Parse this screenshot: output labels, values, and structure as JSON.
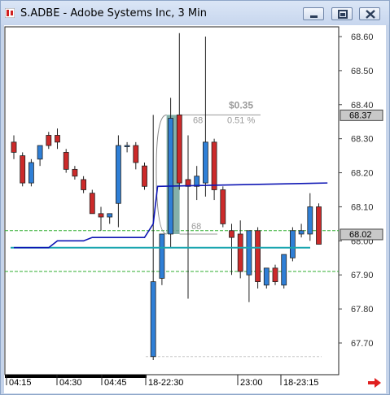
{
  "window": {
    "title": "S.ADBE - Adobe Systems Inc, 3 Min",
    "minimize_icon": "minimize-icon",
    "restore_icon": "restore-icon",
    "close_icon": "close-icon"
  },
  "colors": {
    "up_candle": "#2f7fd6",
    "down_candle": "#cc2a2a",
    "vwap_line": "#0e16b4",
    "teal_line": "#1aa6b0",
    "green_dashed": "#2fae2f",
    "gray_dashed": "#c8c8c8",
    "highlight": "#6fa29a",
    "price_tag_bg": "#c8c8c8",
    "scroll_arrow": "#e02020"
  },
  "price_axis": {
    "labels": [
      "68.60",
      "68.50",
      "68.40",
      "68.30",
      "68.20",
      "68.10",
      "68.00",
      "67.90",
      "67.80",
      "67.70"
    ],
    "current_price_tag": "68.02",
    "high_price_tag": "68.37"
  },
  "time_axis": {
    "labels": [
      "04:15",
      "04:30",
      "04:45",
      "18-22:30",
      "23:00",
      "18-23:15"
    ]
  },
  "annotation": {
    "change": "$0.35",
    "percent": "0.51 %",
    "top_bar_count": "68",
    "bottom_bar_count": "68"
  },
  "chart_data": {
    "type": "candlestick",
    "title": "S.ADBE - Adobe Systems Inc, 3 Min",
    "ylim": [
      67.64,
      68.62
    ],
    "candles": [
      {
        "open": 68.29,
        "high": 68.31,
        "low": 68.24,
        "close": 68.26
      },
      {
        "open": 68.25,
        "high": 68.26,
        "low": 68.16,
        "close": 68.17
      },
      {
        "open": 68.17,
        "high": 68.24,
        "low": 68.16,
        "close": 68.23
      },
      {
        "open": 68.24,
        "high": 68.28,
        "low": 68.22,
        "close": 68.28
      },
      {
        "open": 68.31,
        "high": 68.32,
        "low": 68.27,
        "close": 68.28
      },
      {
        "open": 68.31,
        "high": 68.33,
        "low": 68.27,
        "close": 68.29
      },
      {
        "open": 68.26,
        "high": 68.27,
        "low": 68.2,
        "close": 68.21
      },
      {
        "open": 68.21,
        "high": 68.22,
        "low": 68.18,
        "close": 68.19
      },
      {
        "open": 68.18,
        "high": 68.19,
        "low": 68.14,
        "close": 68.15
      },
      {
        "open": 68.14,
        "high": 68.15,
        "low": 68.08,
        "close": 68.08
      },
      {
        "open": 68.08,
        "high": 68.1,
        "low": 68.03,
        "close": 68.07
      },
      {
        "open": 68.07,
        "high": 68.08,
        "low": 68.05,
        "close": 68.08
      },
      {
        "open": 68.11,
        "high": 68.31,
        "low": 68.04,
        "close": 68.28
      },
      {
        "open": 68.28,
        "high": 68.29,
        "low": 68.26,
        "close": 68.28
      },
      {
        "open": 68.28,
        "high": 68.29,
        "low": 68.21,
        "close": 68.23
      },
      {
        "open": 68.22,
        "high": 68.23,
        "low": 68.15,
        "close": 68.16
      },
      {
        "open": 67.66,
        "high": 68.37,
        "low": 67.65,
        "close": 67.88
      },
      {
        "open": 67.89,
        "high": 68.02,
        "low": 67.87,
        "close": 68.02
      },
      {
        "open": 68.02,
        "high": 68.42,
        "low": 67.98,
        "close": 68.36
      },
      {
        "open": 68.37,
        "high": 68.61,
        "low": 68.15,
        "close": 68.17
      },
      {
        "open": 68.18,
        "high": 68.31,
        "low": 67.83,
        "close": 68.16
      },
      {
        "open": 68.16,
        "high": 68.22,
        "low": 68.12,
        "close": 68.19
      },
      {
        "open": 68.17,
        "high": 68.6,
        "low": 68.13,
        "close": 68.29
      },
      {
        "open": 68.29,
        "high": 68.3,
        "low": 68.12,
        "close": 68.15
      },
      {
        "open": 68.15,
        "high": 68.16,
        "low": 68.04,
        "close": 68.05
      },
      {
        "open": 68.03,
        "high": 68.05,
        "low": 67.9,
        "close": 68.01
      },
      {
        "open": 68.02,
        "high": 68.06,
        "low": 67.89,
        "close": 67.91
      },
      {
        "open": 67.9,
        "high": 68.03,
        "low": 67.82,
        "close": 68.03
      },
      {
        "open": 68.03,
        "high": 68.04,
        "low": 67.86,
        "close": 67.88
      },
      {
        "open": 67.87,
        "high": 67.92,
        "low": 67.86,
        "close": 67.92
      },
      {
        "open": 67.92,
        "high": 67.93,
        "low": 67.87,
        "close": 67.88
      },
      {
        "open": 67.87,
        "high": 67.96,
        "low": 67.86,
        "close": 67.96
      },
      {
        "open": 67.95,
        "high": 68.04,
        "low": 67.94,
        "close": 68.03
      },
      {
        "open": 68.02,
        "high": 68.05,
        "low": 68.01,
        "close": 68.03
      },
      {
        "open": 68.02,
        "high": 68.14,
        "low": 68.0,
        "close": 68.1
      },
      {
        "open": 68.1,
        "high": 68.11,
        "low": 67.99,
        "close": 67.99
      }
    ],
    "vwap": [
      [
        0,
        67.98
      ],
      [
        4,
        67.98
      ],
      [
        5,
        68.0
      ],
      [
        8,
        68.0
      ],
      [
        9,
        68.01
      ],
      [
        15,
        68.01
      ],
      [
        16,
        68.05
      ],
      [
        16.5,
        68.16
      ],
      [
        36,
        68.17
      ]
    ],
    "teal_level": 67.98,
    "green_dashed_levels": [
      68.03,
      67.91
    ],
    "gray_dashed_level": 67.66
  }
}
